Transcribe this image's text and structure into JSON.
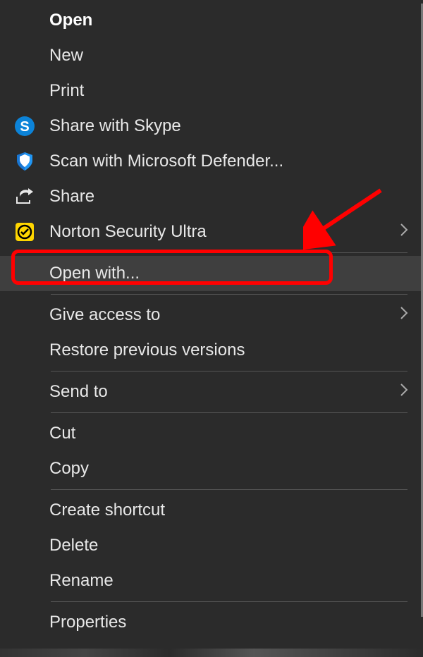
{
  "menu": {
    "items": [
      {
        "label": "Open",
        "bold": true,
        "icon": null,
        "submenu": false
      },
      {
        "label": "New",
        "bold": false,
        "icon": null,
        "submenu": false
      },
      {
        "label": "Print",
        "bold": false,
        "icon": null,
        "submenu": false
      },
      {
        "label": "Share with Skype",
        "bold": false,
        "icon": "skype",
        "submenu": false
      },
      {
        "label": "Scan with Microsoft Defender...",
        "bold": false,
        "icon": "defender",
        "submenu": false
      },
      {
        "label": "Share",
        "bold": false,
        "icon": "share",
        "submenu": false
      },
      {
        "label": "Norton Security Ultra",
        "bold": false,
        "icon": "norton",
        "submenu": true
      },
      {
        "label": "Open with...",
        "bold": false,
        "icon": null,
        "submenu": false,
        "hovered": true
      },
      {
        "label": "Give access to",
        "bold": false,
        "icon": null,
        "submenu": true
      },
      {
        "label": "Restore previous versions",
        "bold": false,
        "icon": null,
        "submenu": false
      },
      {
        "label": "Send to",
        "bold": false,
        "icon": null,
        "submenu": true
      },
      {
        "label": "Cut",
        "bold": false,
        "icon": null,
        "submenu": false
      },
      {
        "label": "Copy",
        "bold": false,
        "icon": null,
        "submenu": false
      },
      {
        "label": "Create shortcut",
        "bold": false,
        "icon": null,
        "submenu": false
      },
      {
        "label": "Delete",
        "bold": false,
        "icon": null,
        "submenu": false
      },
      {
        "label": "Rename",
        "bold": false,
        "icon": null,
        "submenu": false
      },
      {
        "label": "Properties",
        "bold": false,
        "icon": null,
        "submenu": false
      }
    ]
  },
  "annotation": {
    "highlight_target": "Open with...",
    "arrow": true
  }
}
